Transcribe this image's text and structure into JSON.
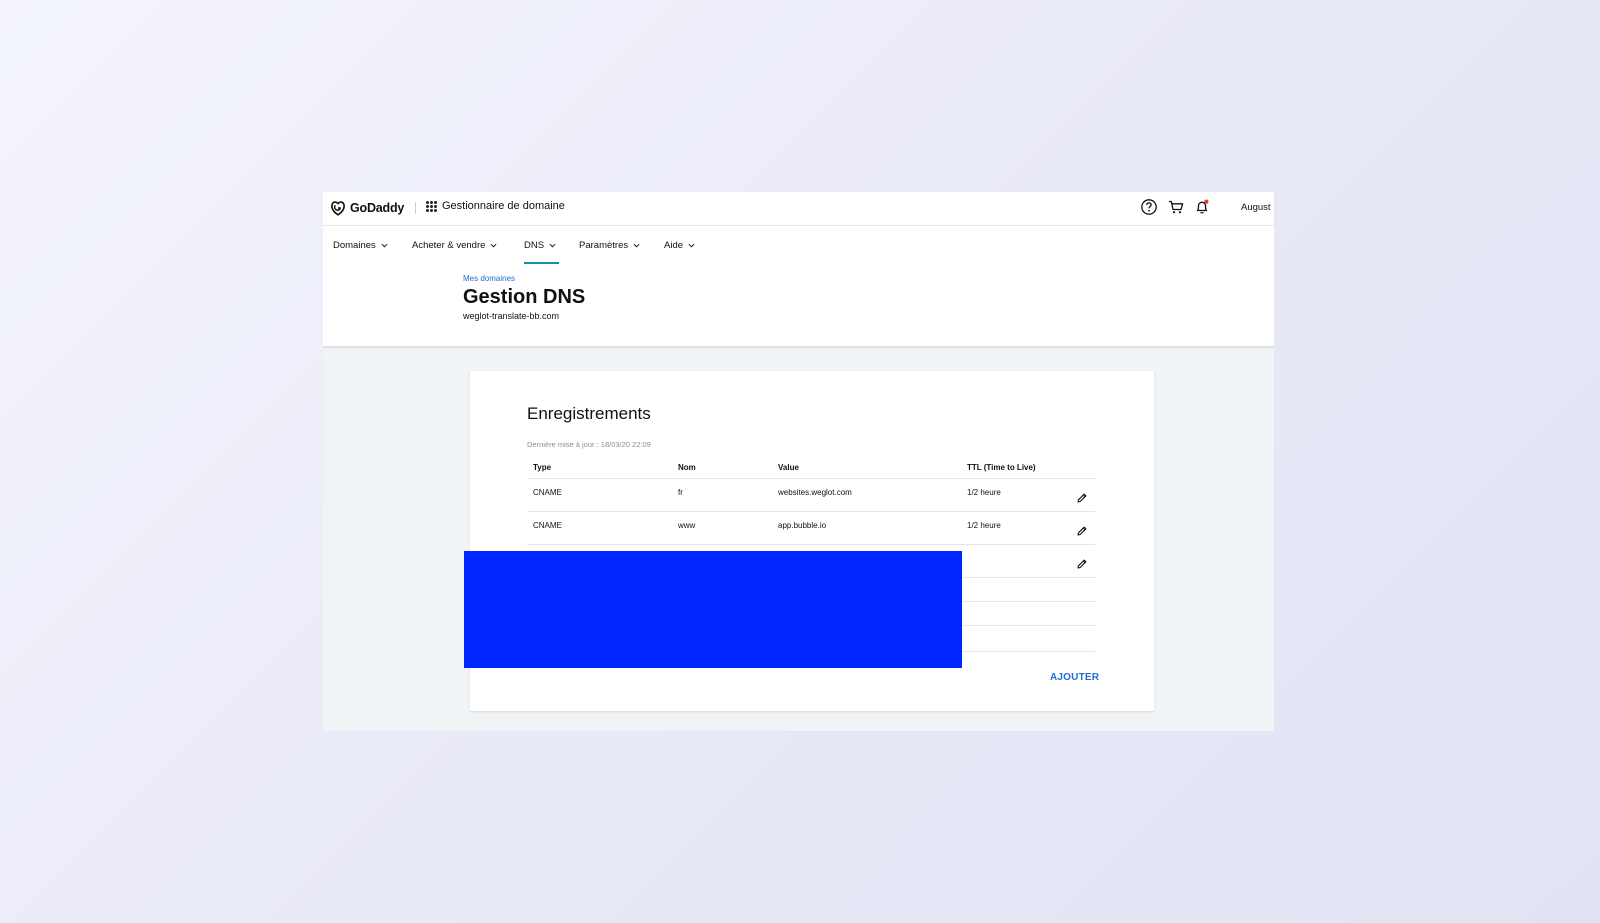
{
  "brand": {
    "name": "GoDaddy",
    "logo_icon": "godaddy-logo-icon"
  },
  "header": {
    "app_title": "Gestionnaire de domaine",
    "apps_icon": "apps-grid-icon",
    "help_icon": "help-circle-icon",
    "cart_icon": "cart-icon",
    "notification_icon": "bell-icon",
    "notification_dot_color": "#e23a2e",
    "user_name": "August"
  },
  "nav": {
    "items": [
      {
        "label": "Domaines",
        "active": false
      },
      {
        "label": "Acheter & vendre",
        "active": false
      },
      {
        "label": "DNS",
        "active": true
      },
      {
        "label": "Paramètres",
        "active": false
      },
      {
        "label": "Aide",
        "active": false
      }
    ],
    "active_color": "#1592a9"
  },
  "page": {
    "breadcrumb": "Mes domaines",
    "title": "Gestion DNS",
    "domain": "weglot-translate-bb.com"
  },
  "records": {
    "title": "Enregistrements",
    "last_updated": "Dernière mise à jour : 18/03/20 22:09",
    "columns": [
      "Type",
      "Nom",
      "Value",
      "TTL (Time to Live)"
    ],
    "rows": [
      {
        "type": "CNAME",
        "name": "fr",
        "value": "websites.weglot.com",
        "ttl": "1/2 heure"
      },
      {
        "type": "CNAME",
        "name": "www",
        "value": "app.bubble.io",
        "ttl": "1/2 heure"
      }
    ],
    "edit_icon": "pencil-icon",
    "redaction_color": "#0026ff",
    "add_label": "AJOUTER",
    "link_color": "#1f6ed4"
  }
}
